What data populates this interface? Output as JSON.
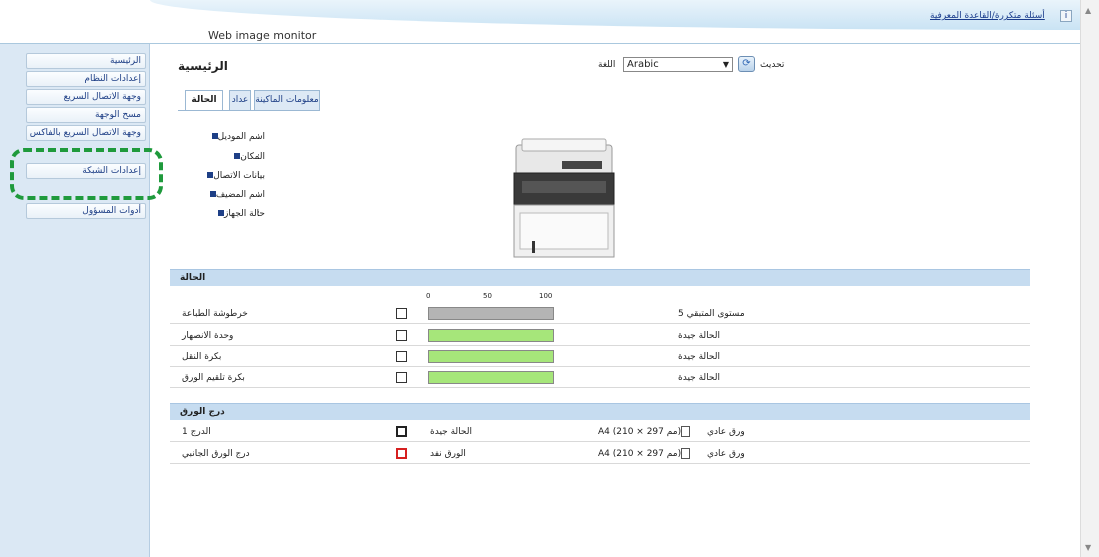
{
  "header": {
    "app_title": "Web image monitor",
    "help_link": "أسئلة متكررة/القاعدة المعرفية",
    "help_icon": "i"
  },
  "sidebar": {
    "items": [
      {
        "label": "الرئيسية"
      },
      {
        "label": "إعدادات النظام"
      },
      {
        "label": "وجهة الاتصال السريع"
      },
      {
        "label": "مسح الوجهة"
      },
      {
        "label": "وجهة الاتصال السريع بالفاكس"
      },
      {
        "label": "إعدادات الشبكة"
      },
      {
        "label": "أدوات المسؤول"
      }
    ]
  },
  "main": {
    "title": "الرئيسية",
    "refresh_label": "تحديث",
    "language_label": "اللغة",
    "language_value": "Arabic",
    "tabs": [
      {
        "label": "الحالة"
      },
      {
        "label": "عداد"
      },
      {
        "label": "معلومات الماكينة"
      }
    ],
    "device_info": [
      {
        "label": "اسم الموديل",
        "value": ":"
      },
      {
        "label": "المكان",
        "value": ":"
      },
      {
        "label": "بيانات الاتصال",
        "value": ":"
      },
      {
        "label": "اسم المضيف",
        "value": ":"
      },
      {
        "label": "حالة الجهاز",
        "value": ":"
      }
    ]
  },
  "status_section": {
    "title": "الحالة",
    "scale": [
      "0",
      "50",
      "100"
    ],
    "rows": [
      {
        "label": "خرطوشة الطباعة",
        "level": 100,
        "color": "#b4b4b4",
        "status": "مستوى المتبقي 5"
      },
      {
        "label": "وحدة الانصهار",
        "level": 100,
        "color": "#a6e67a",
        "status": "الحالة جيدة"
      },
      {
        "label": "بكرة النقل",
        "level": 100,
        "color": "#a6e67a",
        "status": "الحالة جيدة"
      },
      {
        "label": "بكرة تلقيم الورق",
        "level": 100,
        "color": "#a6e67a",
        "status": "الحالة جيدة"
      }
    ]
  },
  "tray_section": {
    "title": "درج الورق",
    "rows": [
      {
        "label": "الدرج 1",
        "status": "الحالة جيدة",
        "paper_size": "A4 (210 × 297 مم)",
        "paper_type": "ورق عادي",
        "icon_color": "#222222"
      },
      {
        "label": "درج الورق الجانبي",
        "status": "الورق نفد",
        "paper_size": "A4 (210 × 297 مم)",
        "paper_type": "ورق عادي",
        "icon_color": "#d62020"
      }
    ]
  },
  "colors": {
    "highlight": "#1f9a3c",
    "sidebar_bg": "#dbe8f4",
    "section_bg": "#c6dcf0"
  }
}
